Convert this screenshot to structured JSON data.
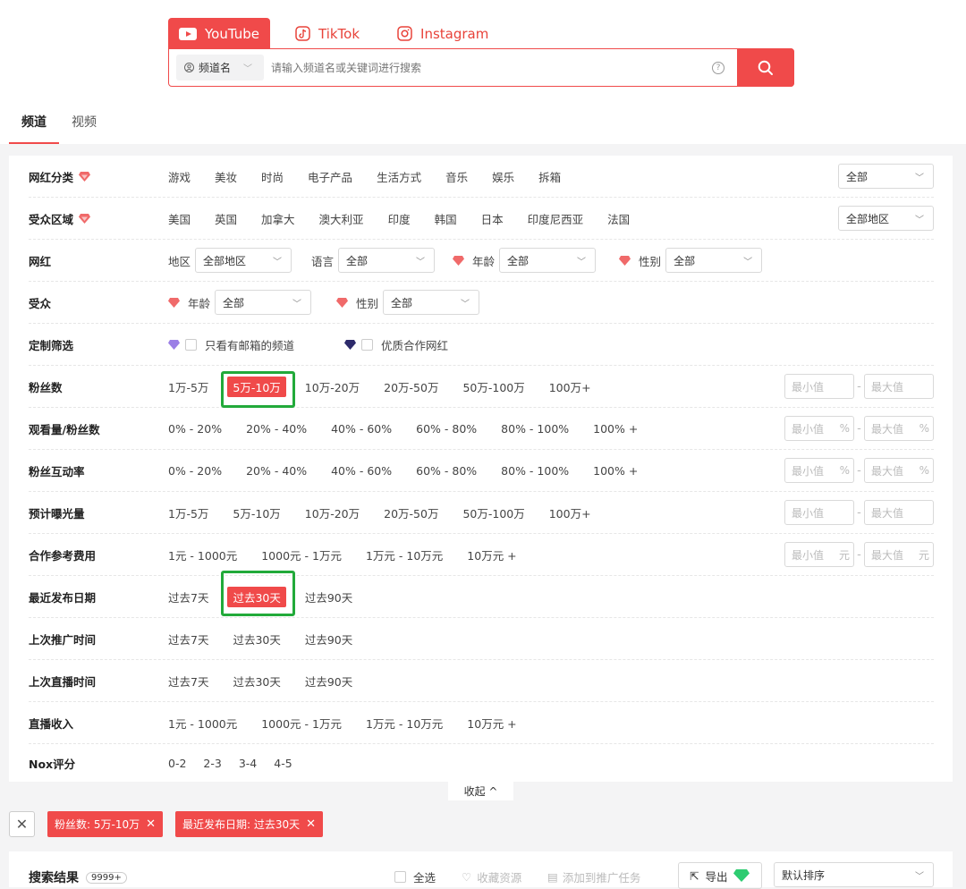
{
  "platform_tabs": [
    {
      "label": "YouTube",
      "icon": "youtube-icon"
    },
    {
      "label": "TikTok",
      "icon": "tiktok-icon"
    },
    {
      "label": "Instagram",
      "icon": "instagram-icon"
    }
  ],
  "search": {
    "type_label": "频道名",
    "placeholder": "请输入频道名或关键词进行搜索"
  },
  "main_tabs": [
    "频道",
    "视频"
  ],
  "filters": {
    "category": {
      "label": "网红分类",
      "options": [
        "游戏",
        "美妆",
        "时尚",
        "电子产品",
        "生活方式",
        "音乐",
        "娱乐",
        "拆箱"
      ],
      "select": "全部"
    },
    "region": {
      "label": "受众区域",
      "options": [
        "美国",
        "英国",
        "加拿大",
        "澳大利亚",
        "印度",
        "韩国",
        "日本",
        "印度尼西亚",
        "法国"
      ],
      "select": "全部地区"
    },
    "influencer": {
      "label": "网红",
      "region_label": "地区",
      "region_value": "全部地区",
      "lang_label": "语言",
      "lang_value": "全部",
      "age_label": "年龄",
      "age_value": "全部",
      "gender_label": "性别",
      "gender_value": "全部"
    },
    "audience": {
      "label": "受众",
      "age_label": "年龄",
      "age_value": "全部",
      "gender_label": "性别",
      "gender_value": "全部"
    },
    "custom": {
      "label": "定制筛选",
      "opt1": "只看有邮箱的频道",
      "opt2": "优质合作网红"
    },
    "fans": {
      "label": "粉丝数",
      "options": [
        "1万-5万",
        "5万-10万",
        "10万-20万",
        "20万-50万",
        "50万-100万",
        "100万+"
      ],
      "selected": "5万-10万"
    },
    "view_ratio": {
      "label": "观看量/粉丝数",
      "options": [
        "0% - 20%",
        "20% - 40%",
        "40% - 60%",
        "60% - 80%",
        "80% - 100%",
        "100% +"
      ]
    },
    "engagement": {
      "label": "粉丝互动率",
      "options": [
        "0% - 20%",
        "20% - 40%",
        "40% - 60%",
        "60% - 80%",
        "80% - 100%",
        "100% +"
      ]
    },
    "exposure": {
      "label": "预计曝光量",
      "options": [
        "1万-5万",
        "5万-10万",
        "10万-20万",
        "20万-50万",
        "50万-100万",
        "100万+"
      ]
    },
    "fee": {
      "label": "合作参考费用",
      "options": [
        "1元 - 1000元",
        "1000元 - 1万元",
        "1万元 - 10万元",
        "10万元 +"
      ]
    },
    "last_post": {
      "label": "最近发布日期",
      "options": [
        "过去7天",
        "过去30天",
        "过去90天"
      ],
      "selected": "过去30天"
    },
    "last_promo": {
      "label": "上次推广时间",
      "options": [
        "过去7天",
        "过去30天",
        "过去90天"
      ]
    },
    "last_live": {
      "label": "上次直播时间",
      "options": [
        "过去7天",
        "过去30天",
        "过去90天"
      ]
    },
    "live_income": {
      "label": "直播收入",
      "options": [
        "1元 - 1000元",
        "1000元 - 1万元",
        "1万元 - 10万元",
        "10万元 +"
      ]
    },
    "nox": {
      "label": "Nox评分",
      "options": [
        "0-2",
        "2-3",
        "3-4",
        "4-5"
      ]
    }
  },
  "range": {
    "min": "最小值",
    "max": "最大值",
    "pct": "%",
    "yuan": "元"
  },
  "collapse_label": "收起 ^",
  "active_chips": [
    "粉丝数: 5万-10万",
    "最近发布日期: 过去30天"
  ],
  "results": {
    "title": "搜索结果",
    "count": "9999+",
    "select_all": "全选",
    "collect": "收藏资源",
    "add_task": "添加到推广任务",
    "export": "导出",
    "sort": "默认排序"
  },
  "colors": {
    "accent": "#f04a4a",
    "highlight": "#22aa3a",
    "gem": "#f06a6a",
    "gem_purple": "#9b7fe6",
    "gem_dark": "#2d2a6b"
  }
}
